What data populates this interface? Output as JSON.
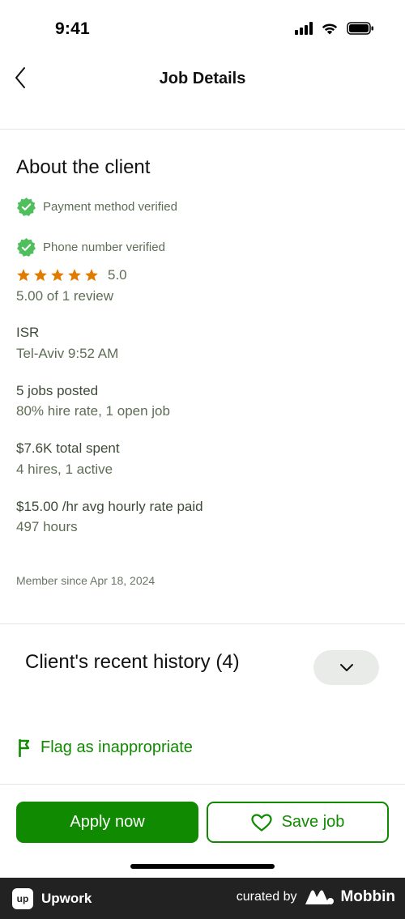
{
  "status_bar": {
    "time": "9:41"
  },
  "header": {
    "title": "Job Details"
  },
  "about": {
    "title": "About the client",
    "verifications": [
      {
        "label": "Payment method verified"
      },
      {
        "label": "Phone number verified"
      }
    ],
    "rating": {
      "stars": 5,
      "value": "5.0",
      "reviews_text": "5.00 of 1 review"
    },
    "location": {
      "country": "ISR",
      "city_time": "Tel-Aviv 9:52 AM"
    },
    "jobs": {
      "posted": "5 jobs posted",
      "detail": "80% hire rate, 1 open job"
    },
    "spent": {
      "total": "$7.6K total spent",
      "detail": "4 hires, 1 active"
    },
    "rate": {
      "avg": "$15.00 /hr avg hourly rate paid",
      "hours": "497 hours"
    },
    "member_since": "Member since Apr 18, 2024"
  },
  "history": {
    "title": "Client's recent history (4)"
  },
  "flag": {
    "label": "Flag as inappropriate"
  },
  "actions": {
    "apply_label": "Apply now",
    "save_label": "Save job"
  },
  "footer": {
    "brand": "Upwork",
    "logo_text": "up",
    "curated_by": "curated by",
    "mobbin": "Mobbin"
  },
  "colors": {
    "brand_green": "#108a00",
    "verified_green": "#4fbe5c",
    "star_orange": "#e07b00",
    "footer_bg": "#222222"
  }
}
